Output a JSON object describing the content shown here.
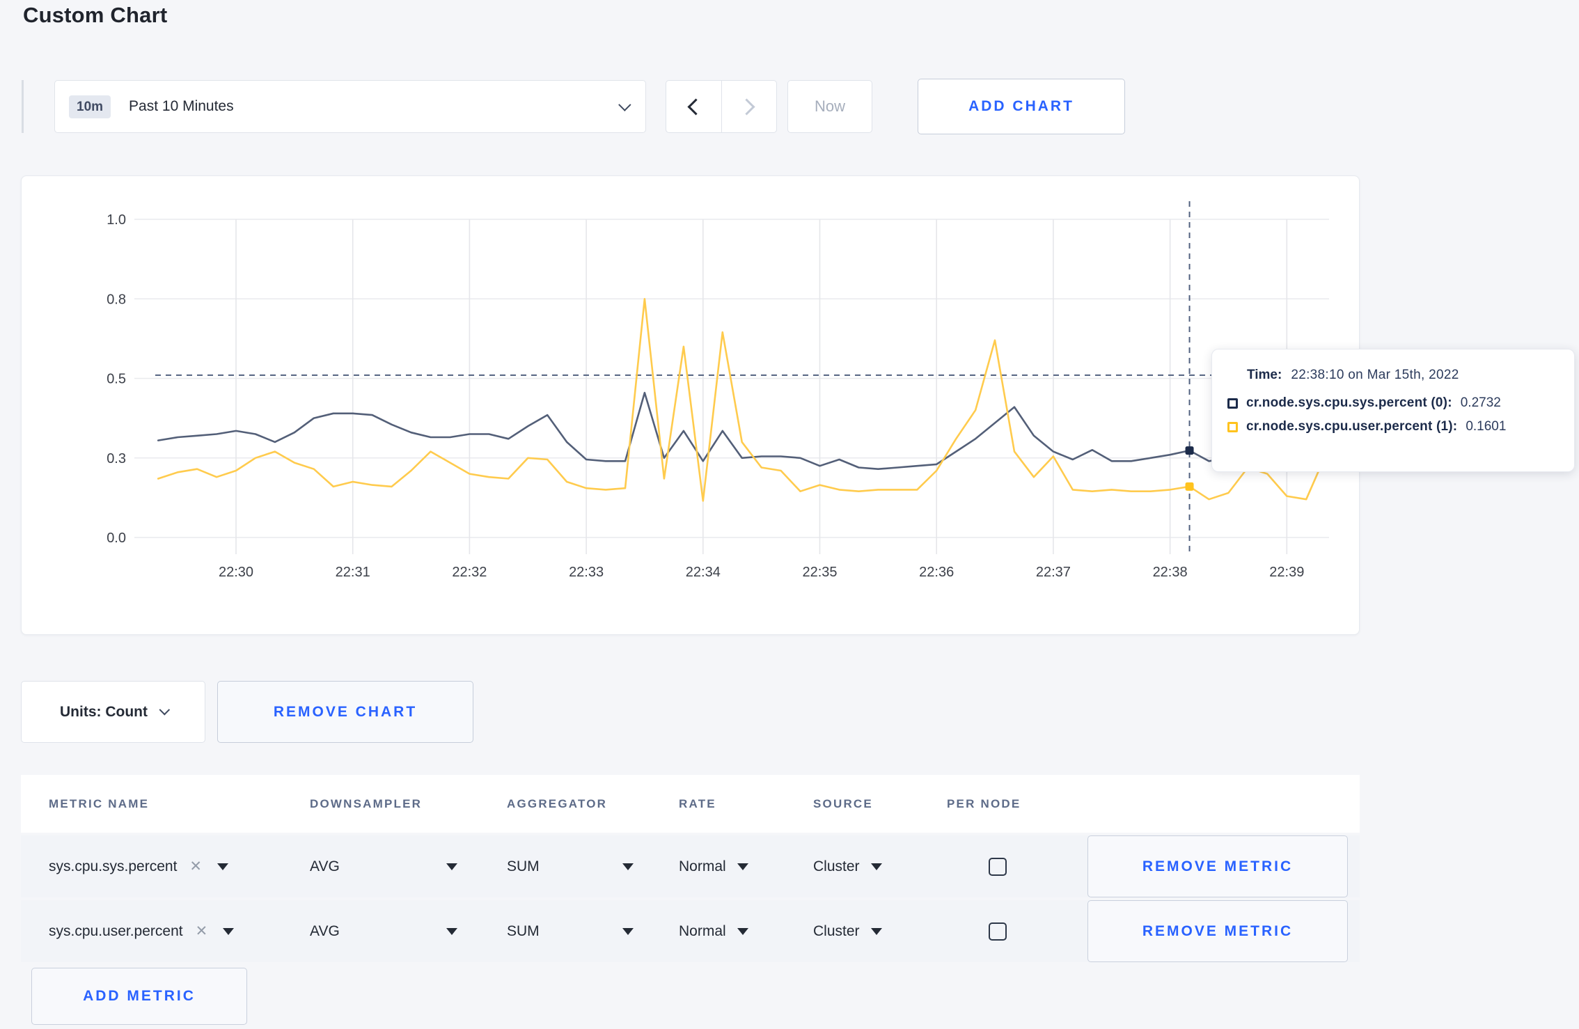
{
  "page": {
    "title": "Custom Chart"
  },
  "colors": {
    "accent_blue": "#2962ff",
    "series_sys_line": "#535f78",
    "series_sys_marker": "#1c2b4a",
    "series_user_line": "#ffcb4d",
    "series_user_marker": "#ffc31e",
    "crosshair": "#51617f",
    "grid": "#e9eaee"
  },
  "toolbar": {
    "time_badge": "10m",
    "time_range_label": "Past 10 Minutes",
    "prev_label": "previous time window",
    "next_label": "next time window",
    "now_label": "Now",
    "add_chart_label": "ADD CHART"
  },
  "chart_data": {
    "type": "line",
    "x_start": "22:29:20",
    "x_step_seconds": 10,
    "x_tick_labels": [
      "22:30",
      "22:31",
      "22:32",
      "22:33",
      "22:34",
      "22:35",
      "22:36",
      "22:37",
      "22:38",
      "22:39"
    ],
    "y_ticks": [
      {
        "value": 0.0,
        "label": "0.0"
      },
      {
        "value": 0.25,
        "label": "0.3"
      },
      {
        "value": 0.5,
        "label": "0.5"
      },
      {
        "value": 0.75,
        "label": "0.8"
      },
      {
        "value": 1.0,
        "label": "1.0"
      }
    ],
    "ylim": [
      0,
      1
    ],
    "grid": true,
    "series": [
      {
        "name": "cr.node.sys.cpu.sys.percent",
        "values": [
          0.305,
          0.315,
          0.32,
          0.325,
          0.335,
          0.325,
          0.3,
          0.33,
          0.375,
          0.39,
          0.39,
          0.385,
          0.355,
          0.33,
          0.315,
          0.315,
          0.325,
          0.325,
          0.31,
          0.35,
          0.385,
          0.3,
          0.245,
          0.24,
          0.24,
          0.455,
          0.25,
          0.335,
          0.24,
          0.335,
          0.25,
          0.255,
          0.255,
          0.25,
          0.225,
          0.245,
          0.22,
          0.215,
          0.22,
          0.225,
          0.23,
          0.27,
          0.31,
          0.36,
          0.41,
          0.32,
          0.27,
          0.245,
          0.275,
          0.24,
          0.24,
          0.25,
          0.26,
          0.2732,
          0.24,
          0.25,
          0.255,
          0.26,
          0.265,
          0.28,
          0.3
        ]
      },
      {
        "name": "cr.node.sys.cpu.user.percent",
        "values": [
          0.185,
          0.205,
          0.215,
          0.19,
          0.21,
          0.25,
          0.27,
          0.235,
          0.215,
          0.16,
          0.175,
          0.165,
          0.16,
          0.21,
          0.27,
          0.235,
          0.2,
          0.19,
          0.185,
          0.25,
          0.245,
          0.175,
          0.155,
          0.15,
          0.155,
          0.75,
          0.185,
          0.6,
          0.115,
          0.645,
          0.3,
          0.22,
          0.21,
          0.145,
          0.165,
          0.15,
          0.145,
          0.15,
          0.15,
          0.15,
          0.21,
          0.31,
          0.4,
          0.62,
          0.27,
          0.19,
          0.255,
          0.15,
          0.145,
          0.15,
          0.145,
          0.145,
          0.15,
          0.1601,
          0.12,
          0.14,
          0.22,
          0.2,
          0.13,
          0.12,
          0.26
        ]
      }
    ],
    "crosshair": {
      "time": "22:38:10",
      "y_value": 0.51
    }
  },
  "tooltip": {
    "time_label": "Time:",
    "time_value": "22:38:10 on Mar 15th, 2022",
    "series": [
      {
        "label": "cr.node.sys.cpu.sys.percent (0):",
        "value": "0.2732",
        "color": "#1c2b4a"
      },
      {
        "label": "cr.node.sys.cpu.user.percent (1):",
        "value": "0.1601",
        "color": "#ffc31e"
      }
    ]
  },
  "chart_controls": {
    "units_label": "Units: Count",
    "remove_chart_label": "REMOVE CHART"
  },
  "metrics_table": {
    "headers": {
      "metric_name": "METRIC NAME",
      "downsampler": "DOWNSAMPLER",
      "aggregator": "AGGREGATOR",
      "rate": "RATE",
      "source": "SOURCE",
      "per_node": "PER NODE"
    },
    "remove_metric_label": "REMOVE METRIC",
    "add_metric_label": "ADD METRIC",
    "close_icon": "✕",
    "rows": [
      {
        "metric_name": "sys.cpu.sys.percent",
        "downsampler": "AVG",
        "aggregator": "SUM",
        "rate": "Normal",
        "source": "Cluster",
        "per_node_checked": false
      },
      {
        "metric_name": "sys.cpu.user.percent",
        "downsampler": "AVG",
        "aggregator": "SUM",
        "rate": "Normal",
        "source": "Cluster",
        "per_node_checked": false
      }
    ]
  }
}
